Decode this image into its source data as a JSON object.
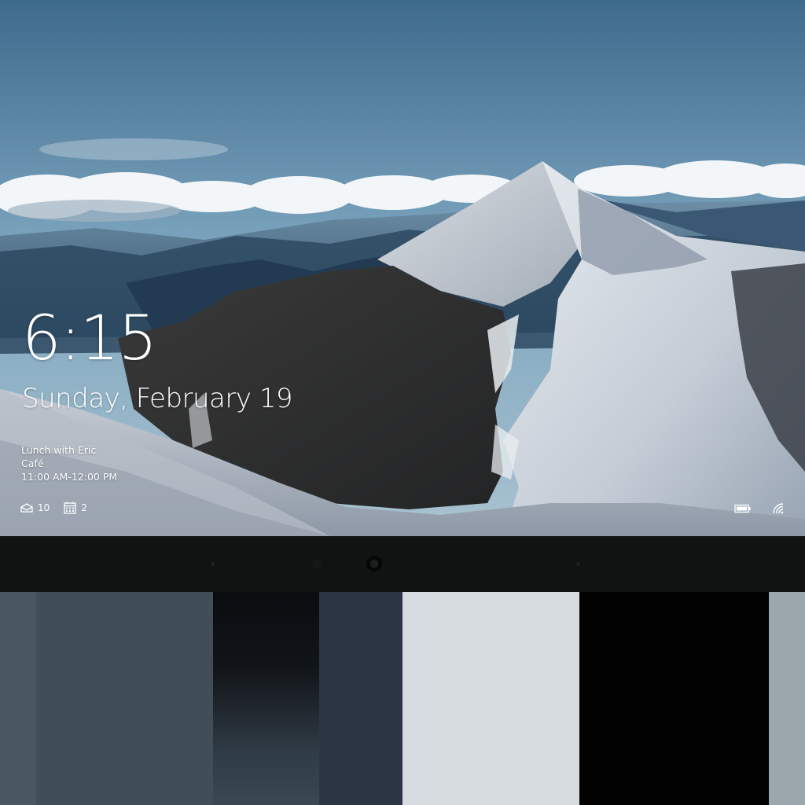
{
  "lock_screen": {
    "time": "6:15",
    "date": "Sunday, February 19",
    "event": {
      "title": "Lunch with Eric",
      "location": "Café",
      "time_range": "11:00 AM-12:00 PM"
    },
    "badges": {
      "mail_count": "10",
      "calendar_count": "2"
    },
    "icons": [
      "mail-icon",
      "calendar-icon",
      "battery-icon",
      "wifi-icon"
    ]
  },
  "palette": {
    "swatches": [
      "#4a5660",
      "#414d57",
      "#0a0c10",
      "#2c3644",
      "#d6dcdf",
      "#020203",
      "#9ba7ac"
    ]
  }
}
